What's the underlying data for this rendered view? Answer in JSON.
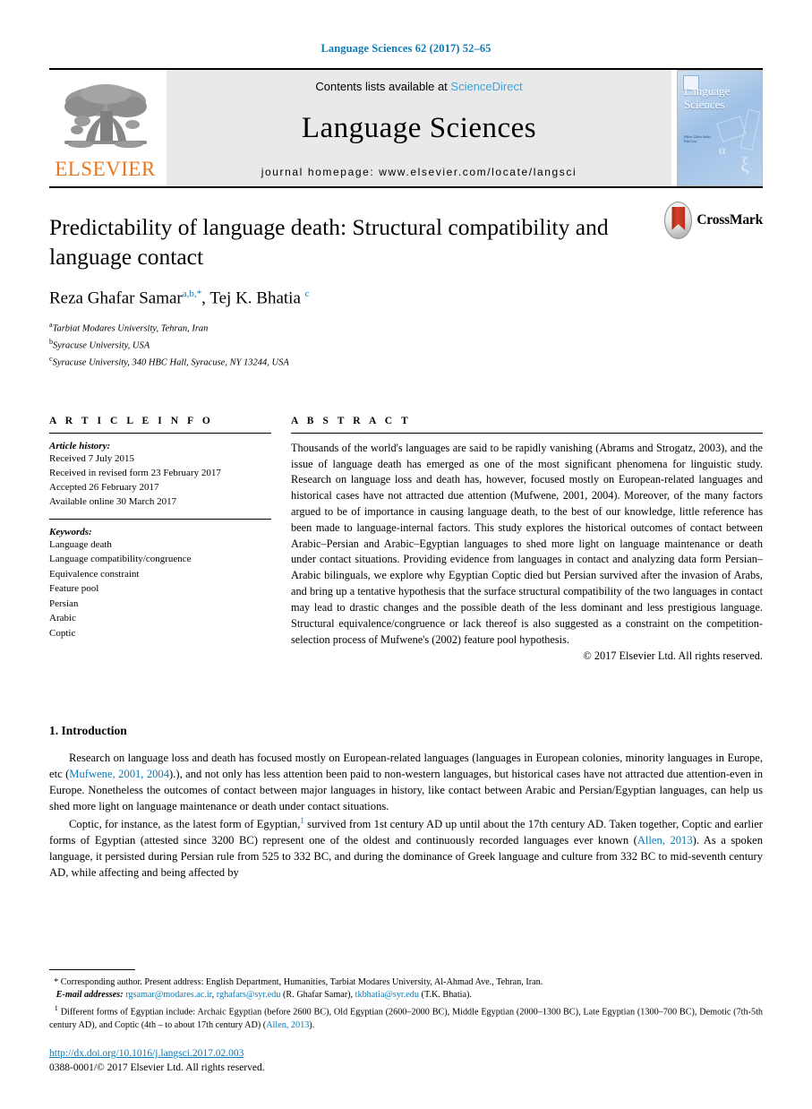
{
  "running_head": "Language Sciences 62 (2017) 52–65",
  "masthead": {
    "publisher_name": "ELSEVIER",
    "contents_prefix": "Contents lists available at ",
    "contents_link": "ScienceDirect",
    "journal_title": "Language Sciences",
    "homepage": "journal homepage: www.elsevier.com/locate/langsci",
    "cover_title_line1": "Language",
    "cover_title_line2": "Sciences",
    "cover_alpha": "α",
    "cover_xi": "ξ",
    "cover_small_text": "Editor: Gábor Szabó, Paul Gray"
  },
  "article": {
    "title": "Predictability of language death: Structural compatibility and language contact",
    "authors_html": "Reza Ghafar Samar",
    "author1": "Reza Ghafar Samar",
    "author1_sup": "a,b,*",
    "author2": "Tej K. Bhatia",
    "author2_sup": "c",
    "affiliations": [
      {
        "sup": "a",
        "text": "Tarbiat Modares University, Tehran, Iran"
      },
      {
        "sup": "b",
        "text": "Syracuse University, USA"
      },
      {
        "sup": "c",
        "text": "Syracuse University, 340 HBC Hall, Syracuse, NY 13244, USA"
      }
    ],
    "crossmark_label": "CrossMark"
  },
  "article_info": {
    "heading": "A R T I C L E  I N F O",
    "history_label": "Article history:",
    "history": [
      "Received 7 July 2015",
      "Received in revised form 23 February 2017",
      "Accepted 26 February 2017",
      "Available online 30 March 2017"
    ],
    "keywords_label": "Keywords:",
    "keywords": [
      "Language death",
      "Language compatibility/congruence",
      "Equivalence constraint",
      "Feature pool",
      "Persian",
      "Arabic",
      "Coptic"
    ]
  },
  "abstract": {
    "heading": "A B S T R A C T",
    "text": "Thousands of the world's languages are said to be rapidly vanishing (Abrams and Strogatz, 2003), and the issue of language death has emerged as one of the most significant phenomena for linguistic study. Research on language loss and death has, however, focused mostly on European-related languages and historical cases have not attracted due attention (Mufwene, 2001, 2004). Moreover, of the many factors argued to be of importance in causing language death, to the best of our knowledge, little reference has been made to language-internal factors. This study explores the historical outcomes of contact between Arabic–Persian and Arabic–Egyptian languages to shed more light on language maintenance or death under contact situations. Providing evidence from languages in contact and analyzing data form Persian–Arabic bilinguals, we explore why Egyptian Coptic died but Persian survived after the invasion of Arabs, and bring up a tentative hypothesis that the surface structural compatibility of the two languages in contact may lead to drastic changes and the possible death of the less dominant and less prestigious language. Structural equivalence/congruence or lack thereof is also suggested as a constraint on the competition-selection process of Mufwene's (2002) feature pool hypothesis.",
    "copyright": "© 2017 Elsevier Ltd. All rights reserved."
  },
  "introduction": {
    "number_title": "1. Introduction",
    "para1_a": "Research on language loss and death has focused mostly on European-related languages (languages in European colonies, minority languages in Europe, etc (",
    "para1_ref": "Mufwene, 2001, 2004",
    "para1_b": ").), and not only has less attention been paid to non-western languages, but historical cases have not attracted due attention-even in Europe. Nonetheless the outcomes of contact between major languages in history, like contact between Arabic and Persian/Egyptian languages, can help us shed more light on language maintenance or death under contact situations.",
    "para2_a": "Coptic, for instance, as the latest form of Egyptian,",
    "para2_fn": "1",
    "para2_b": " survived from 1st century AD up until about the 17th century AD. Taken together, Coptic and earlier forms of Egyptian (attested since 3200 BC) represent one of the oldest and continuously recorded languages ever known (",
    "para2_ref": "Allen, 2013",
    "para2_c": "). As a spoken language, it persisted during Persian rule from 525 to 332 BC, and during the dominance of Greek language and culture from 332 BC to mid-seventh century AD, while affecting and being affected by"
  },
  "footer": {
    "corresponding_mark": "*",
    "corresponding_text": "Corresponding author. Present address: English Department, Humanities, Tarbiat Modares University, Al-Ahmad Ave., Tehran, Iran.",
    "email_label": "E-mail addresses:",
    "email1": "rgsamar@modares.ac.ir",
    "email2": "rghafars@syr.edu",
    "email2_owner": "(R. Ghafar Samar),",
    "email3": "tkbhatia@syr.edu",
    "email3_owner": "(T.K. Bhatia).",
    "footnote_mark": "1",
    "footnote_text_a": "Different forms of Egyptian include: Archaic Egyptian (before 2600 BC), Old Egyptian (2600–2000 BC), Middle Egyptian (2000–1300 BC), Late Egyptian (1300–700 BC), Demotic (7th-5th century AD), and Coptic (4th – to about 17th century AD) (",
    "footnote_ref": "Allen, 2013",
    "footnote_text_b": ").",
    "doi": "http://dx.doi.org/10.1016/j.langsci.2017.02.003",
    "issn": "0388-0001/© 2017 Elsevier Ltd. All rights reserved."
  },
  "colors": {
    "link": "#0b7ab5",
    "elsevier_orange": "#E87722",
    "sciencedirect": "#3aa6dd"
  }
}
